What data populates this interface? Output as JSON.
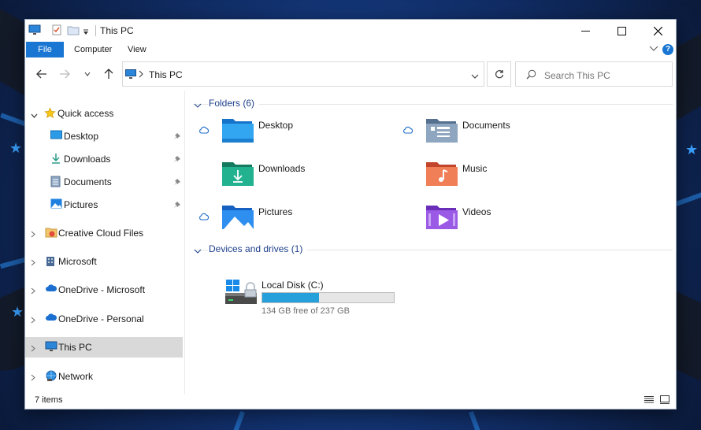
{
  "window": {
    "title": "This PC",
    "minimize_icon": "minimize-icon",
    "maximize_icon": "maximize-icon",
    "close_icon": "close-icon"
  },
  "ribbon": {
    "tabs": [
      "File",
      "Computer",
      "View"
    ],
    "help_label": "?"
  },
  "address": {
    "path": "This PC",
    "search_placeholder": "Search This PC"
  },
  "nav": {
    "quick_access": "Quick access",
    "quick_items": [
      "Desktop",
      "Downloads",
      "Documents",
      "Pictures"
    ],
    "items": [
      "Creative Cloud Files",
      "Microsoft",
      "OneDrive - Microsoft",
      "OneDrive - Personal",
      "This PC",
      "Network"
    ],
    "selected": "This PC"
  },
  "content": {
    "folders_header": "Folders (6)",
    "folders": [
      "Desktop",
      "Documents",
      "Downloads",
      "Music",
      "Pictures",
      "Videos"
    ],
    "devices_header": "Devices and drives (1)",
    "drive": {
      "label": "Local Disk (C:)",
      "free_text": "134 GB free of 237 GB",
      "used_fraction": 0.43
    }
  },
  "status": {
    "item_count": "7 items"
  },
  "colors": {
    "accent": "#1976d2",
    "group_header": "#1e3f8a",
    "drive_fill": "#26a0da",
    "selected_bg": "#d9d9d9"
  }
}
